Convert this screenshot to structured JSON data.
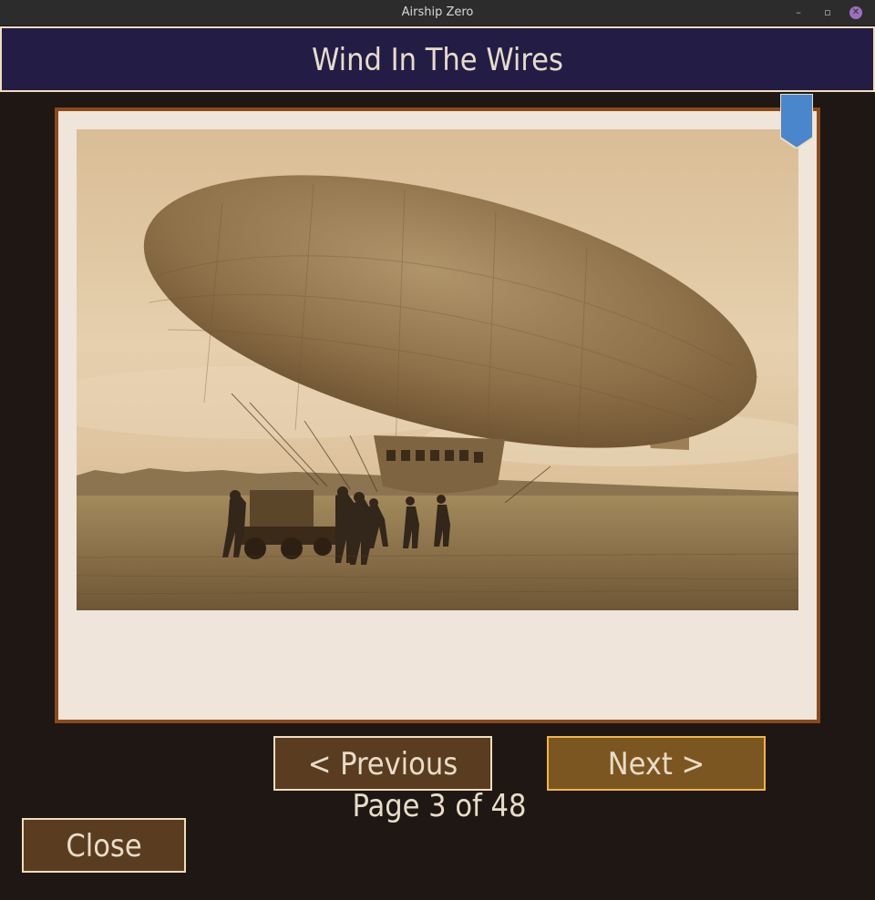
{
  "window": {
    "title": "Airship Zero",
    "controls": {
      "minimize": "–",
      "maximize": "▫",
      "close": "✕"
    }
  },
  "book": {
    "page_title": "Wind In The Wires",
    "photo_icon": "airship-photo",
    "bookmark_color": "#4a86cc",
    "current_page": 3,
    "total_pages": 48,
    "page_indicator": "Page 3 of 48"
  },
  "nav": {
    "previous_label": "< Previous",
    "next_label": "Next >",
    "close_label": "Close"
  },
  "colors": {
    "background": "#1e1713",
    "header_bg": "#231d45",
    "frame_border": "#8a4a1b",
    "button_bg": "#5a3c20",
    "button_active_bg": "#7c5620",
    "button_active_border": "#f2b641",
    "sepia": "#c8a97a"
  }
}
